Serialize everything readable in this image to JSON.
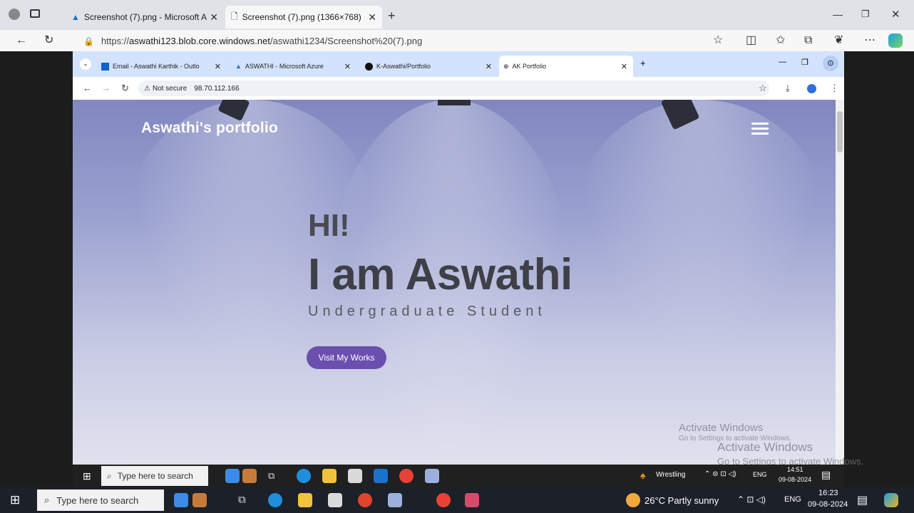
{
  "outer": {
    "tabs": [
      {
        "label": "Screenshot (7).png - Microsoft A"
      },
      {
        "label": "Screenshot (7).png (1366×768)"
      }
    ],
    "url_prefix": "https://",
    "url_host": "aswathi123.blob.core.windows.net",
    "url_path": "/aswathi1234/Screenshot%20(7).png"
  },
  "inner": {
    "tabs": [
      {
        "label": "Email - Aswathi Karthik - Outlo"
      },
      {
        "label": "ASWATHI - Microsoft Azure"
      },
      {
        "label": "K-Aswathi/Portfolio"
      },
      {
        "label": "AK Portfolio"
      }
    ],
    "not_secure": "Not secure",
    "url": "98.70.112.166"
  },
  "site": {
    "brand": "Aswathi's portfolio",
    "greeting": "HI!",
    "headline": "I am Aswathi",
    "role": "Undergraduate Student",
    "cta": "Visit My Works"
  },
  "watermark": {
    "title": "Activate Windows",
    "sub": "Go to Settings to activate Windows."
  },
  "inner_taskbar": {
    "search": "Type here to search",
    "weather": "Wrestling",
    "lang": "ENG",
    "time": "14:51",
    "date": "09-08-2024"
  },
  "outer_taskbar": {
    "search": "Type here to search",
    "weather": "26°C  Partly sunny",
    "lang": "ENG",
    "time": "16:23",
    "date": "09-08-2024"
  },
  "colors": {
    "accent": "#6b4fae",
    "hero_top": "#8087bf",
    "hero_bottom": "#e6e7f1"
  }
}
